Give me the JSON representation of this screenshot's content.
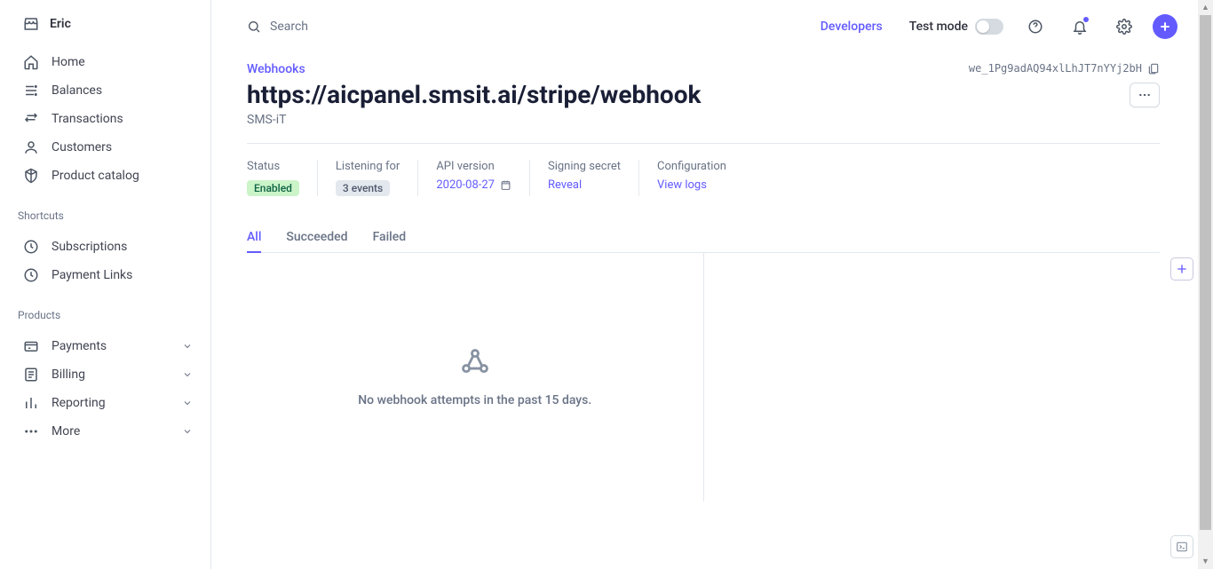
{
  "account": {
    "name": "Eric"
  },
  "search": {
    "placeholder": "Search"
  },
  "topbar": {
    "developers": "Developers",
    "test_mode": "Test mode"
  },
  "nav": {
    "main": [
      {
        "label": "Home"
      },
      {
        "label": "Balances"
      },
      {
        "label": "Transactions"
      },
      {
        "label": "Customers"
      },
      {
        "label": "Product catalog"
      }
    ],
    "shortcuts_label": "Shortcuts",
    "shortcuts": [
      {
        "label": "Subscriptions"
      },
      {
        "label": "Payment Links"
      }
    ],
    "products_label": "Products",
    "products": [
      {
        "label": "Payments"
      },
      {
        "label": "Billing"
      },
      {
        "label": "Reporting"
      },
      {
        "label": "More"
      }
    ]
  },
  "page": {
    "breadcrumb": "Webhooks",
    "id": "we_1Pg9adAQ94xlLhJT7nYYj2bH",
    "title": "https://aicpanel.smsit.ai/stripe/webhook",
    "subtitle": "SMS-iT"
  },
  "meta": {
    "status_label": "Status",
    "status_value": "Enabled",
    "listening_label": "Listening for",
    "listening_value": "3 events",
    "api_label": "API version",
    "api_value": "2020-08-27",
    "secret_label": "Signing secret",
    "secret_action": "Reveal",
    "config_label": "Configuration",
    "config_action": "View logs"
  },
  "tabs": {
    "all": "All",
    "succeeded": "Succeeded",
    "failed": "Failed"
  },
  "empty": {
    "message": "No webhook attempts in the past 15 days."
  }
}
